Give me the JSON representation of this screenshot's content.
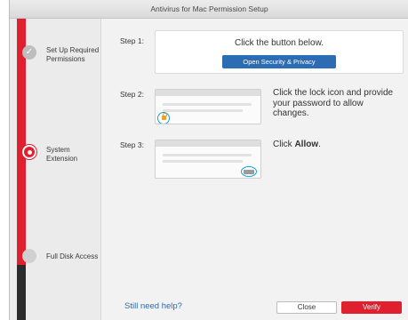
{
  "window": {
    "title": "Antivirus for Mac Permission Setup"
  },
  "sidebar": {
    "items": [
      {
        "label_line1": "Set Up Required",
        "label_line2": "Permissions",
        "state": "done"
      },
      {
        "label_line1": "System",
        "label_line2": "Extension",
        "state": "active"
      },
      {
        "label_line1": "Full Disk Access",
        "label_line2": "",
        "state": "pending"
      }
    ]
  },
  "steps": [
    {
      "label": "Step 1:",
      "text": "Click the button below.",
      "button": "Open Security & Privacy"
    },
    {
      "label": "Step 2:",
      "text_line1": "Click the lock icon and provide",
      "text_line2": "your password to allow",
      "text_line3": "changes."
    },
    {
      "label": "Step 3:",
      "text_prefix": "Click ",
      "text_bold": "Allow",
      "text_suffix": "."
    }
  ],
  "footer": {
    "help_link": "Still need help?",
    "close_label": "Close",
    "verify_label": "Verify"
  },
  "colors": {
    "accent_red": "#e0202e",
    "link_blue": "#2b6cb3",
    "highlight_ring": "#1aa0d8"
  }
}
